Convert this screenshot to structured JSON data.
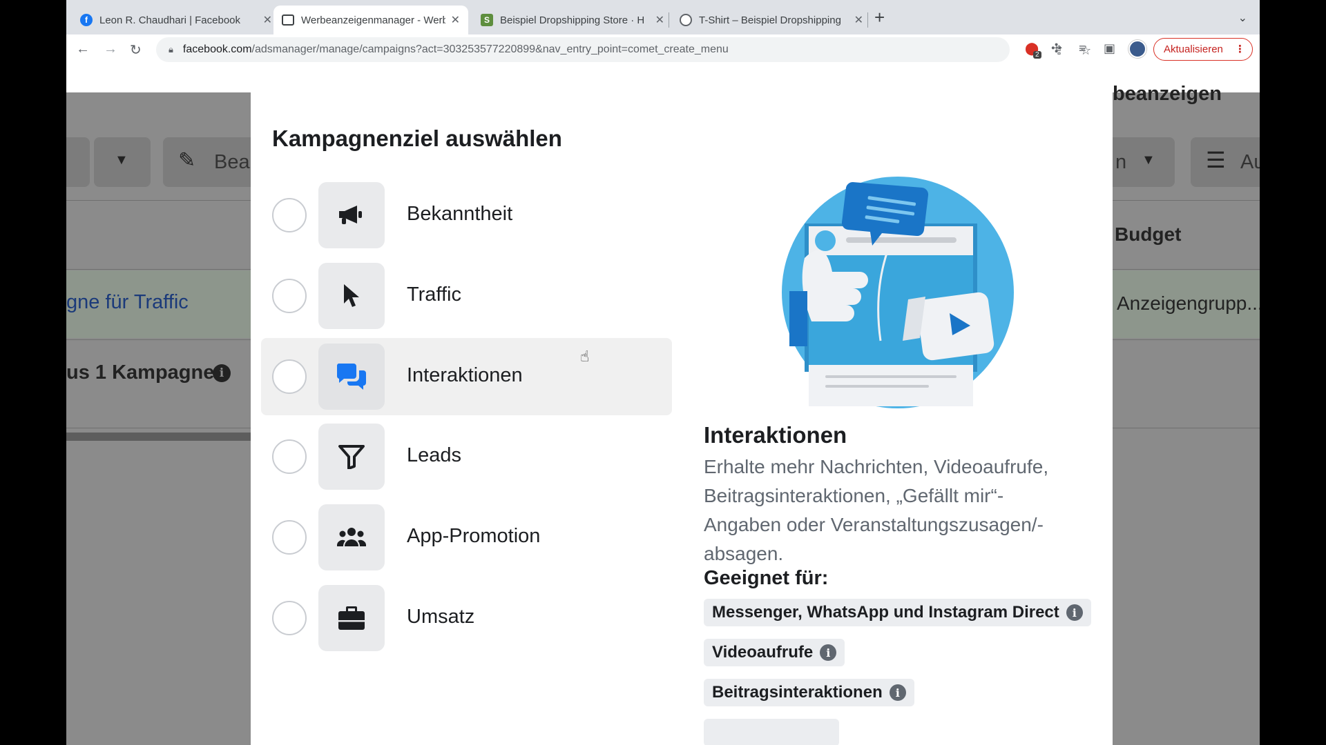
{
  "browser": {
    "tabs": [
      {
        "title": "Leon R. Chaudhari | Facebook",
        "icon": "facebook-icon",
        "color": "#1877f2"
      },
      {
        "title": "Werbeanzeigenmanager - Werb",
        "icon": "ads-manager-icon",
        "color": "#3c4043"
      },
      {
        "title": "Beispiel Dropshipping Store · H",
        "icon": "shopify-icon",
        "color": "#5e8e3e"
      },
      {
        "title": "T-Shirt – Beispiel Dropshipping",
        "icon": "globe-icon",
        "color": "#5f6368"
      }
    ],
    "url_host": "facebook.com",
    "url_path": "/adsmanager/manage/campaigns?act=303253577220899&nav_entry_point=comet_create_menu",
    "update_label": "Aktualisieren",
    "extension_badge": "2"
  },
  "background": {
    "edit_label": "Bear",
    "campaign_link": "gne für Traffic",
    "campaign_count": "us 1 Kampagne",
    "header_right": "beanzeigen",
    "filter_right": "n",
    "columns_label": "Au",
    "budget_header": "Budget",
    "adset_cell": "Anzeigengrupp..."
  },
  "modal": {
    "title": "Kampagnenziel auswählen",
    "options": [
      {
        "label": "Bekanntheit",
        "icon": "megaphone-icon"
      },
      {
        "label": "Traffic",
        "icon": "cursor-icon"
      },
      {
        "label": "Interaktionen",
        "icon": "chat-bubbles-icon"
      },
      {
        "label": "Leads",
        "icon": "filter-icon"
      },
      {
        "label": "App-Promotion",
        "icon": "people-icon"
      },
      {
        "label": "Umsatz",
        "icon": "briefcase-icon"
      }
    ],
    "hovered_index": 2,
    "detail": {
      "title": "Interaktionen",
      "description": "Erhalte mehr Nachrichten, Videoaufrufe, Beitragsinteraktionen, „Gefällt mir“-Angaben oder Veranstaltungszusagen/-absagen.",
      "suited_for_label": "Geeignet für:",
      "chips": [
        "Messenger, WhatsApp und Instagram Direct",
        "Videoaufrufe",
        "Beitragsinteraktionen"
      ]
    }
  },
  "colors": {
    "accent_blue": "#1877f2",
    "illustration_blue": "#4db3e6",
    "update_red": "#d93025"
  }
}
